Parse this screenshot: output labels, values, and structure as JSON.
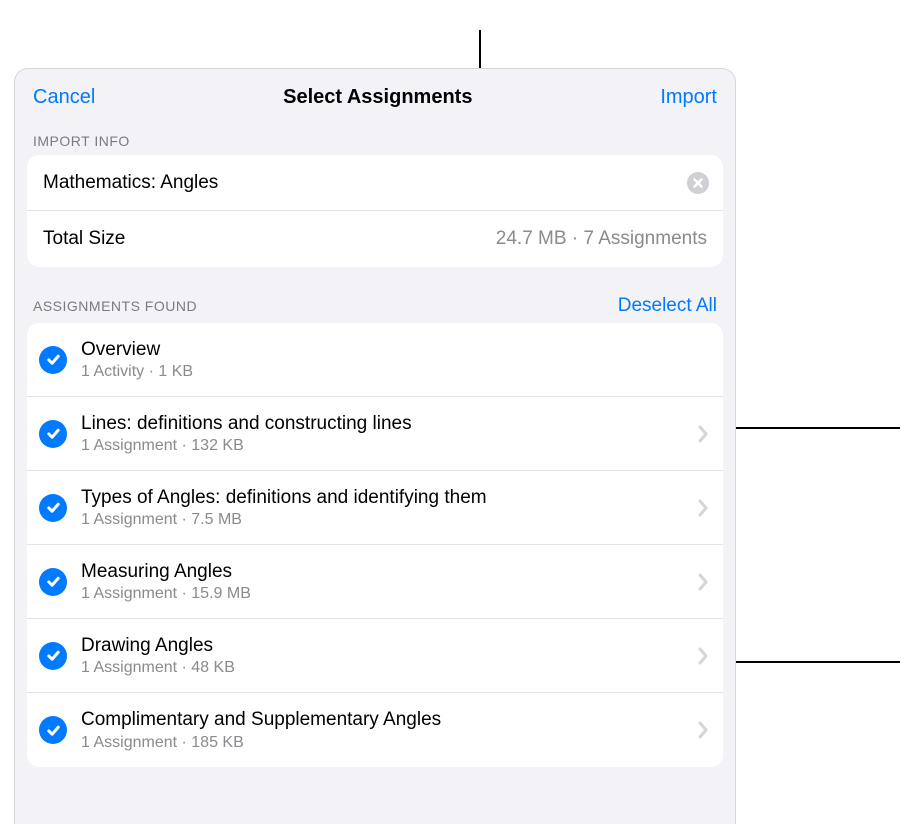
{
  "nav": {
    "cancel": "Cancel",
    "title": "Select Assignments",
    "import": "Import"
  },
  "sections": {
    "import_info": "IMPORT INFO",
    "assignments_found": "ASSIGNMENTS FOUND",
    "deselect_all": "Deselect All"
  },
  "import_info": {
    "name": "Mathematics: Angles",
    "total_size_label": "Total Size",
    "total_size_value": "24.7 MB · 7 Assignments"
  },
  "assignments": [
    {
      "title": "Overview",
      "subtitle": "1 Activity · 1 KB",
      "checked": true,
      "disclosure": false
    },
    {
      "title": "Lines: definitions and constructing lines",
      "subtitle": "1 Assignment · 132 KB",
      "checked": true,
      "disclosure": true
    },
    {
      "title": "Types of Angles: definitions and identifying them",
      "subtitle": "1 Assignment · 7.5 MB",
      "checked": true,
      "disclosure": true
    },
    {
      "title": "Measuring Angles",
      "subtitle": "1 Assignment · 15.9 MB",
      "checked": true,
      "disclosure": true
    },
    {
      "title": "Drawing Angles",
      "subtitle": "1 Assignment · 48 KB",
      "checked": true,
      "disclosure": true
    },
    {
      "title": "Complimentary and Supplementary Angles",
      "subtitle": "1 Assignment · 185 KB",
      "checked": true,
      "disclosure": true
    }
  ]
}
